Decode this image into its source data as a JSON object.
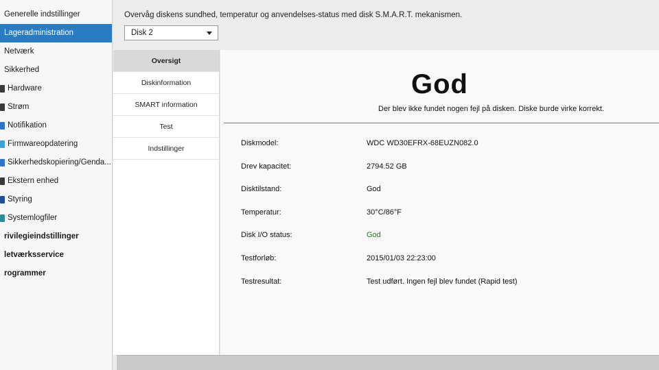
{
  "sidebar": {
    "items": [
      {
        "label": "Generelle indstillinger",
        "icon": "",
        "active": false,
        "bold": false
      },
      {
        "label": "Lageradministration",
        "icon": "",
        "active": true,
        "bold": false
      },
      {
        "label": "Netværk",
        "icon": "",
        "active": false,
        "bold": false
      },
      {
        "label": "Sikkerhed",
        "icon": "",
        "active": false,
        "bold": false
      },
      {
        "label": "Hardware",
        "icon": "hardware-icon",
        "active": false,
        "bold": false
      },
      {
        "label": "Strøm",
        "icon": "power-icon",
        "active": false,
        "bold": false
      },
      {
        "label": "Notifikation",
        "icon": "notification-icon",
        "active": false,
        "bold": false
      },
      {
        "label": "Firmwareopdatering",
        "icon": "firmware-icon",
        "active": false,
        "bold": false
      },
      {
        "label": "Sikkerhedskopiering/Genda...",
        "icon": "backup-icon",
        "active": false,
        "bold": false
      },
      {
        "label": "Ekstern enhed",
        "icon": "external-device-icon",
        "active": false,
        "bold": false
      },
      {
        "label": "Styring",
        "icon": "control-icon",
        "active": false,
        "bold": false
      },
      {
        "label": "Systemlogfiler",
        "icon": "log-icon",
        "active": false,
        "bold": false
      },
      {
        "label": "rivilegieindstillinger",
        "icon": "",
        "active": false,
        "bold": true
      },
      {
        "label": "letværksservice",
        "icon": "",
        "active": false,
        "bold": true
      },
      {
        "label": "rogrammer",
        "icon": "",
        "active": false,
        "bold": true
      }
    ]
  },
  "header": {
    "description": "Overvåg diskens sundhed, temperatur og anvendelses-status med disk S.M.A.R.T. mekanismen.",
    "disk_select": {
      "value": "Disk 2"
    }
  },
  "tabs": [
    {
      "label": "Oversigt",
      "active": true
    },
    {
      "label": "Diskinformation",
      "active": false
    },
    {
      "label": "SMART information",
      "active": false
    },
    {
      "label": "Test",
      "active": false
    },
    {
      "label": "Indstillinger",
      "active": false
    }
  ],
  "summary": {
    "status": "God",
    "message": "Der blev ikke fundet nogen fejl på disken. Diske burde virke korrekt."
  },
  "details": [
    {
      "label": "Diskmodel:",
      "value": "WDC WD30EFRX-68EUZN082.0",
      "good": false
    },
    {
      "label": "Drev kapacitet:",
      "value": "2794.52 GB",
      "good": false
    },
    {
      "label": "Disktilstand:",
      "value": "God",
      "good": false
    },
    {
      "label": "Temperatur:",
      "value": "30°C/86°F",
      "good": false
    },
    {
      "label": "Disk I/O status:",
      "value": "God",
      "good": true
    },
    {
      "label": "Testforløb:",
      "value": "2015/01/03 22:23:00",
      "good": false
    },
    {
      "label": "Testresultat:",
      "value": "Test udført. Ingen fejl blev fundet (Rapid test)",
      "good": false
    }
  ],
  "colors": {
    "accent": "#2a7bc0",
    "good": "#1e7a1e"
  }
}
